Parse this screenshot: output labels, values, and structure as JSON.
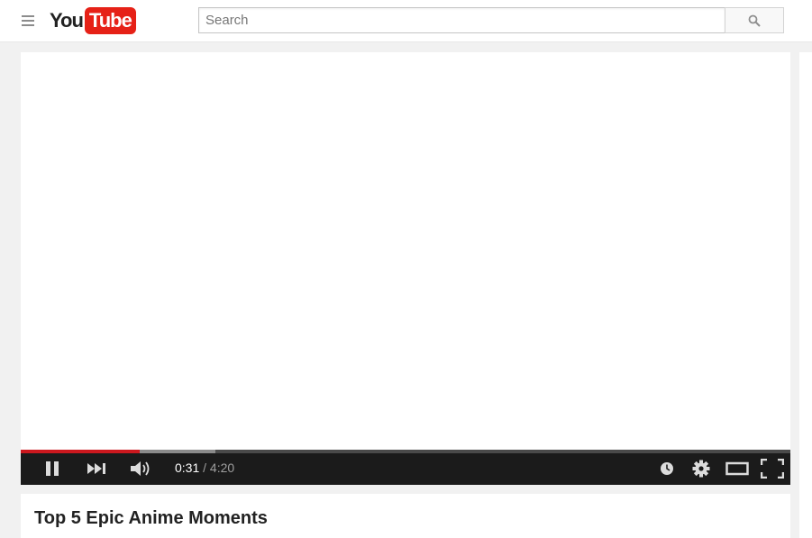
{
  "header": {
    "logo": {
      "you": "You",
      "tube": "Tube"
    },
    "search": {
      "placeholder": "Search",
      "value": ""
    },
    "icons": {
      "menu": "hamburger-menu-icon",
      "search": "search-icon"
    }
  },
  "player": {
    "current_time": "0:31",
    "separator": "/",
    "duration": "4:20",
    "progress": {
      "played_fraction": 0.155,
      "loaded_fraction": 0.253
    },
    "icons": [
      "pause-icon",
      "next-icon",
      "volume-icon",
      "watch-later-icon",
      "settings-icon",
      "theater-mode-icon",
      "fullscreen-icon"
    ],
    "colors": {
      "played": "#cc181e",
      "bar": "#1b1b1b"
    }
  },
  "video": {
    "title": "Top 5 Epic Anime Moments"
  },
  "colors": {
    "brand": "#e62117",
    "background": "#f1f1f1"
  }
}
